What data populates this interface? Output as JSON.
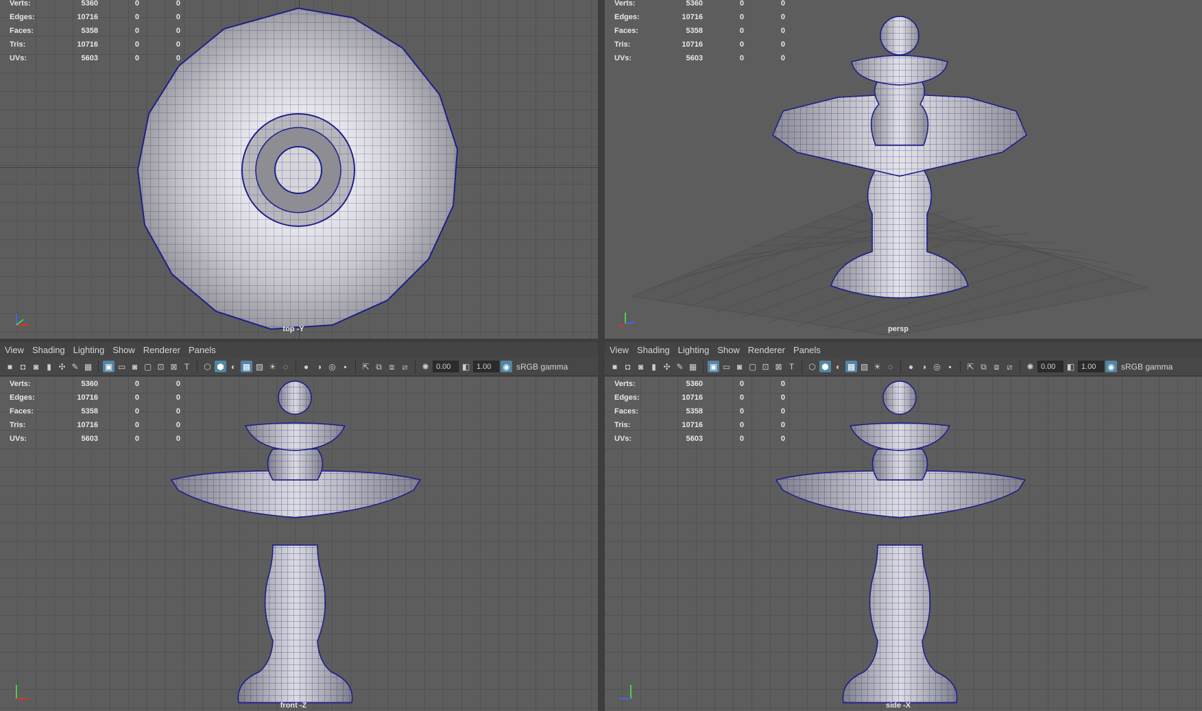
{
  "menus": [
    "View",
    "Shading",
    "Lighting",
    "Show",
    "Renderer",
    "Panels"
  ],
  "toolbar": {
    "exposure": "0.00",
    "gamma": "1.00",
    "color_space": "sRGB gamma"
  },
  "hud": {
    "rows": [
      {
        "label": "Verts:",
        "value": "5360",
        "a": "0",
        "b": "0"
      },
      {
        "label": "Edges:",
        "value": "10716",
        "a": "0",
        "b": "0"
      },
      {
        "label": "Faces:",
        "value": "5358",
        "a": "0",
        "b": "0"
      },
      {
        "label": "Tris:",
        "value": "10716",
        "a": "0",
        "b": "0"
      },
      {
        "label": "UVs:",
        "value": "5603",
        "a": "0",
        "b": "0"
      }
    ]
  },
  "viewports": {
    "top": {
      "camera": "top -Y"
    },
    "persp": {
      "camera": "persp"
    },
    "front": {
      "camera": "front -Z"
    },
    "side": {
      "camera": "side -X"
    }
  },
  "colors": {
    "wire": "#1c1f8a",
    "viewport_bg": "#5d5d5d",
    "grid": "#525252",
    "accent": "#5285a6"
  }
}
